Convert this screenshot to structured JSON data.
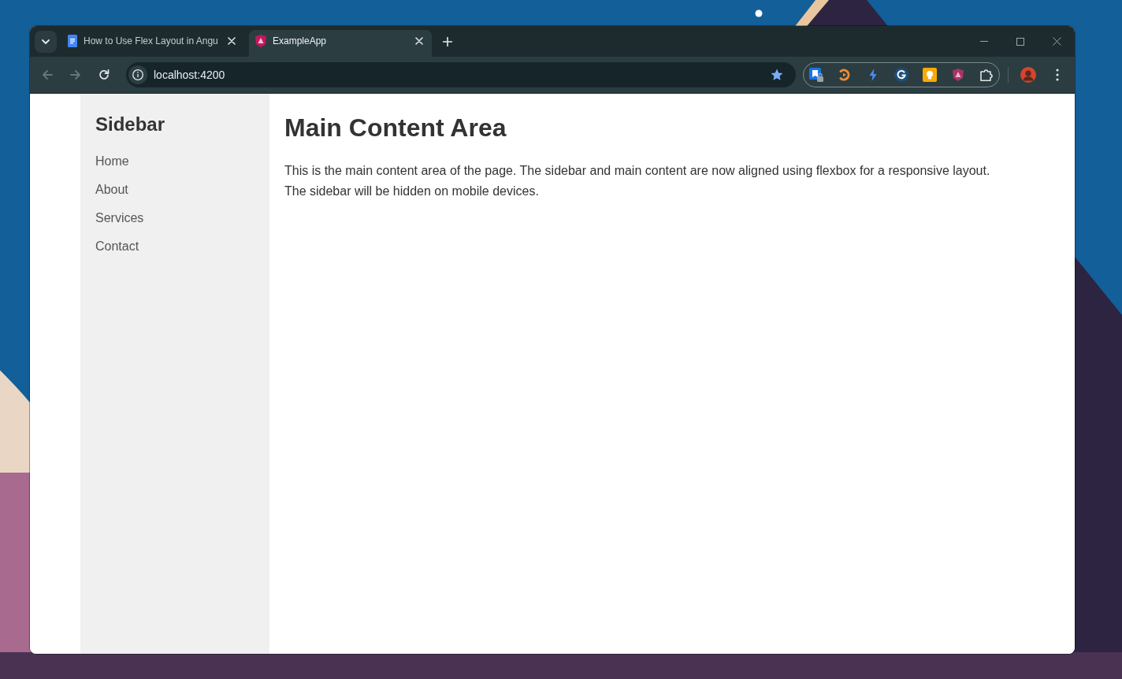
{
  "tabs": [
    {
      "kind": "document",
      "title": "How to Use Flex Layout in Angu",
      "selected": false
    },
    {
      "kind": "app",
      "title": "ExampleApp",
      "selected": true
    }
  ],
  "navigation": [
    {
      "kind": "back",
      "disabled": true
    },
    {
      "kind": "forward",
      "disabled": true
    },
    {
      "kind": "reload",
      "disabled": false
    }
  ],
  "address_bar": {
    "url": "localhost:4200",
    "bookmarked": true
  },
  "page": {
    "sidebar": {
      "title": "Sidebar",
      "links": [
        "Home",
        "About",
        "Services",
        "Contact"
      ]
    },
    "main": {
      "heading": "Main Content Area",
      "body": "This is the main content area of the page. The sidebar and main content are now aligned using flexbox for a responsive layout.\nThe sidebar will be hidden on mobile devices."
    }
  }
}
